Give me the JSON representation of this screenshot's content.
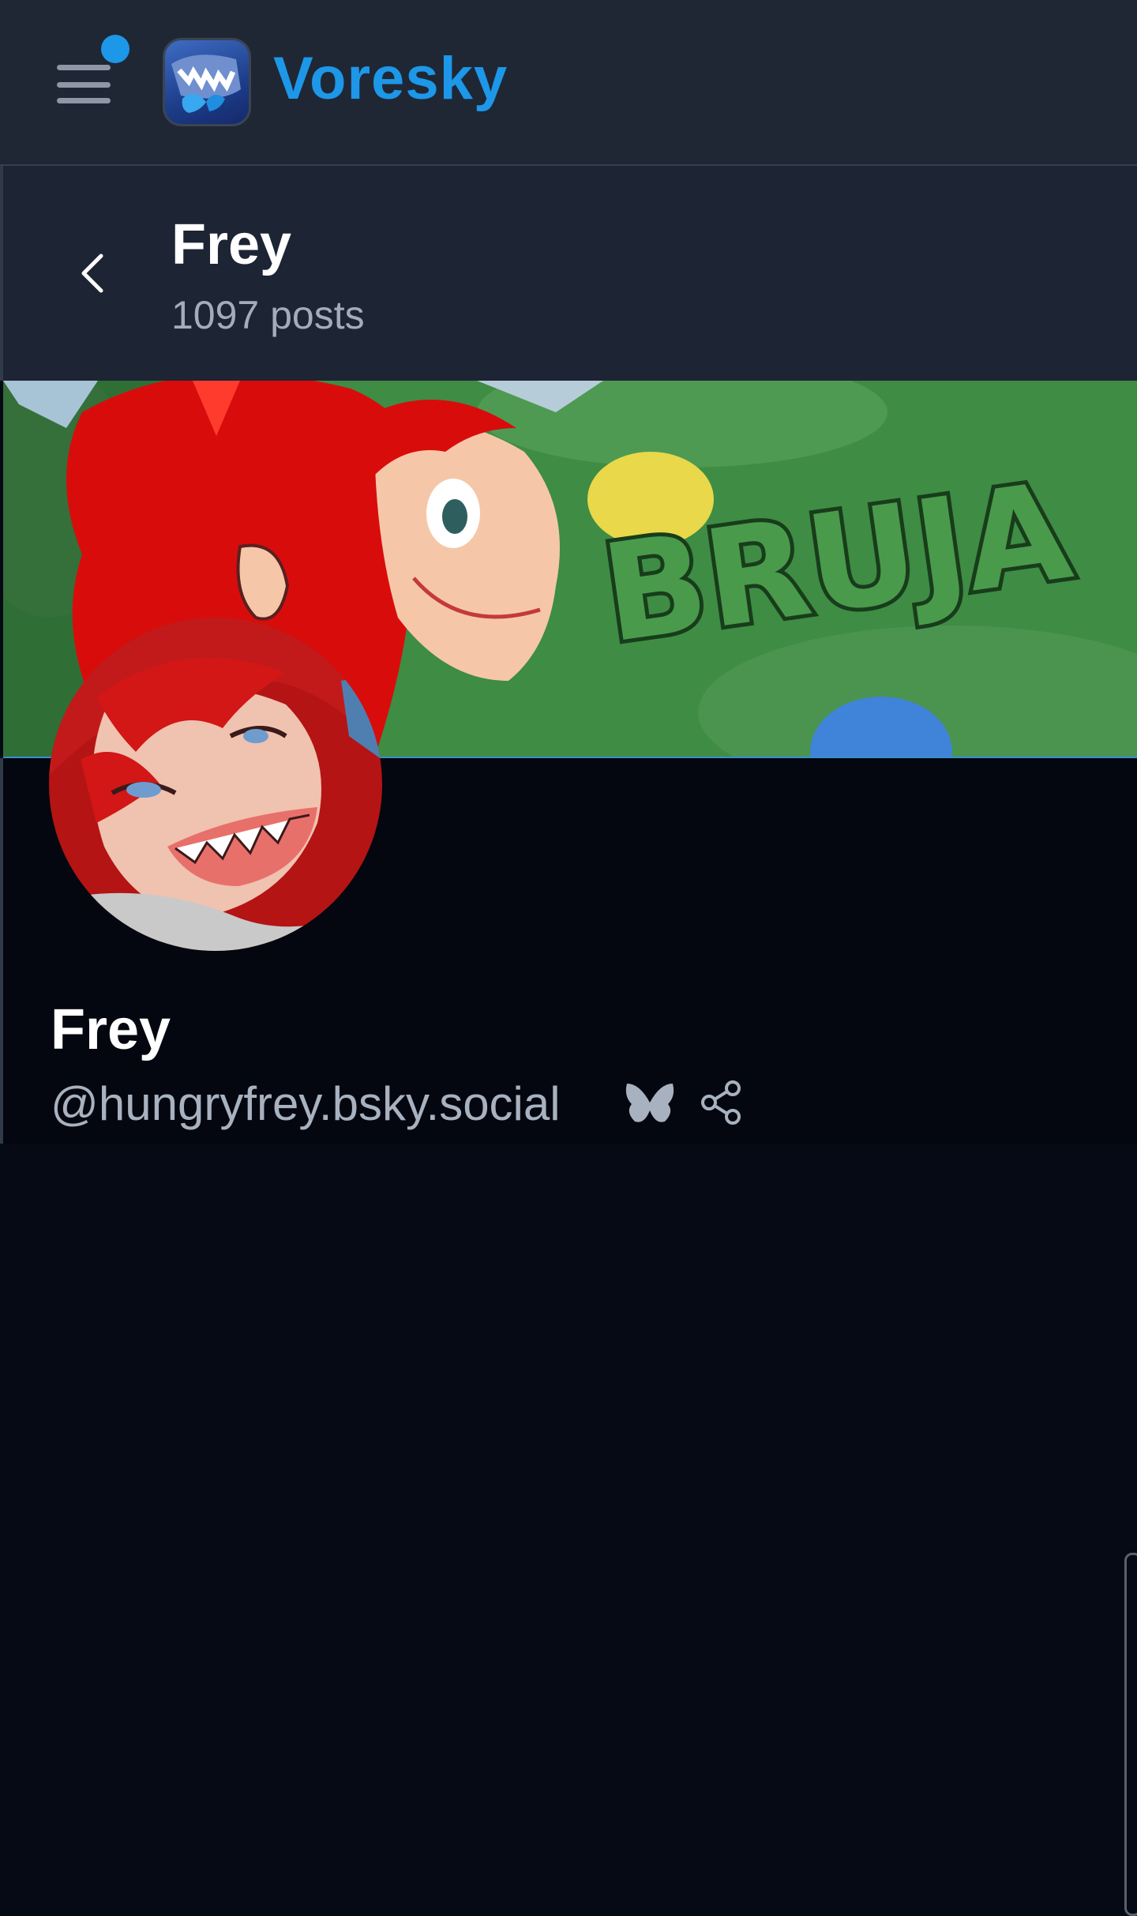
{
  "app": {
    "name": "Voresky",
    "accent_color": "#1d97e8",
    "menu_icon": "hamburger-menu-icon",
    "has_notification_dot": true,
    "logo_icon": "voresky-logo-icon"
  },
  "header": {
    "back_icon": "chevron-left-icon",
    "title": "Frey",
    "posts_count": "1097 posts"
  },
  "profile": {
    "banner_image": "banner-artwork",
    "banner_text": "BRUJA",
    "avatar_image": "avatar-artwork",
    "display_name": "Frey",
    "handle": "@hungryfrey.bsky.social",
    "bluesky_icon": "butterfly-icon",
    "share_icon": "share-icon"
  }
}
